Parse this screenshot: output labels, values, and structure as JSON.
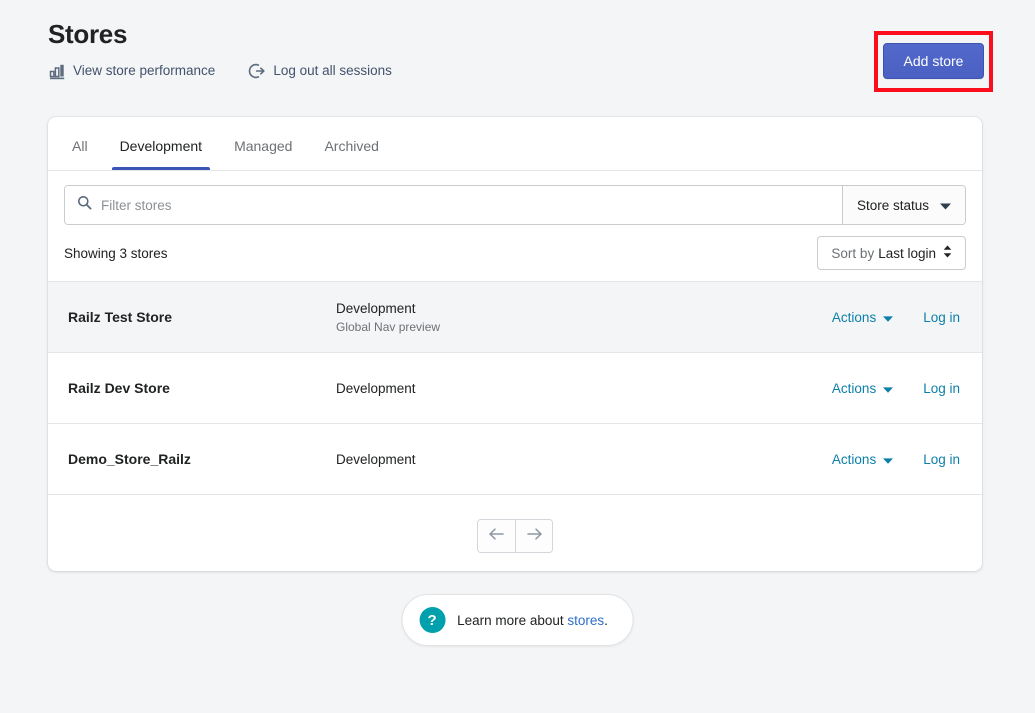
{
  "header": {
    "title": "Stores",
    "links": [
      {
        "label": "View store performance",
        "icon": "bar-chart-icon"
      },
      {
        "label": "Log out all sessions",
        "icon": "logout-icon"
      }
    ],
    "add_store_label": "Add store",
    "annotation_color": "#fc0d1b",
    "button_color": "#4a62c5"
  },
  "tabs": [
    {
      "label": "All",
      "active": false
    },
    {
      "label": "Development",
      "active": true
    },
    {
      "label": "Managed",
      "active": false
    },
    {
      "label": "Archived",
      "active": false
    }
  ],
  "filter": {
    "search_placeholder": "Filter stores",
    "search_value": "",
    "search_icon": "search-icon",
    "status_label": "Store status",
    "status_icon": "chevron-down-icon"
  },
  "list_controls": {
    "showing_text": "Showing 3 stores",
    "sort_prefix": "Sort by",
    "sort_value": "Last login",
    "sort_icon": "sort-updown-icon"
  },
  "stores": [
    {
      "name": "Railz Test Store",
      "plan": "Development",
      "plan_sub": "Global Nav preview",
      "actions_label": "Actions",
      "login_label": "Log in",
      "highlighted": true
    },
    {
      "name": "Railz Dev Store",
      "plan": "Development",
      "plan_sub": "",
      "actions_label": "Actions",
      "login_label": "Log in",
      "highlighted": false
    },
    {
      "name": "Demo_Store_Railz",
      "plan": "Development",
      "plan_sub": "",
      "actions_label": "Actions",
      "login_label": "Log in",
      "highlighted": false
    }
  ],
  "pagination": {
    "prev_icon": "arrow-left-icon",
    "next_icon": "arrow-right-icon"
  },
  "footer": {
    "help_icon": "question-mark-icon",
    "text_before": "Learn more about ",
    "link_label": "stores",
    "text_after": ".",
    "accent_color": "#00a0ac",
    "link_color": "#2c6ecb"
  }
}
